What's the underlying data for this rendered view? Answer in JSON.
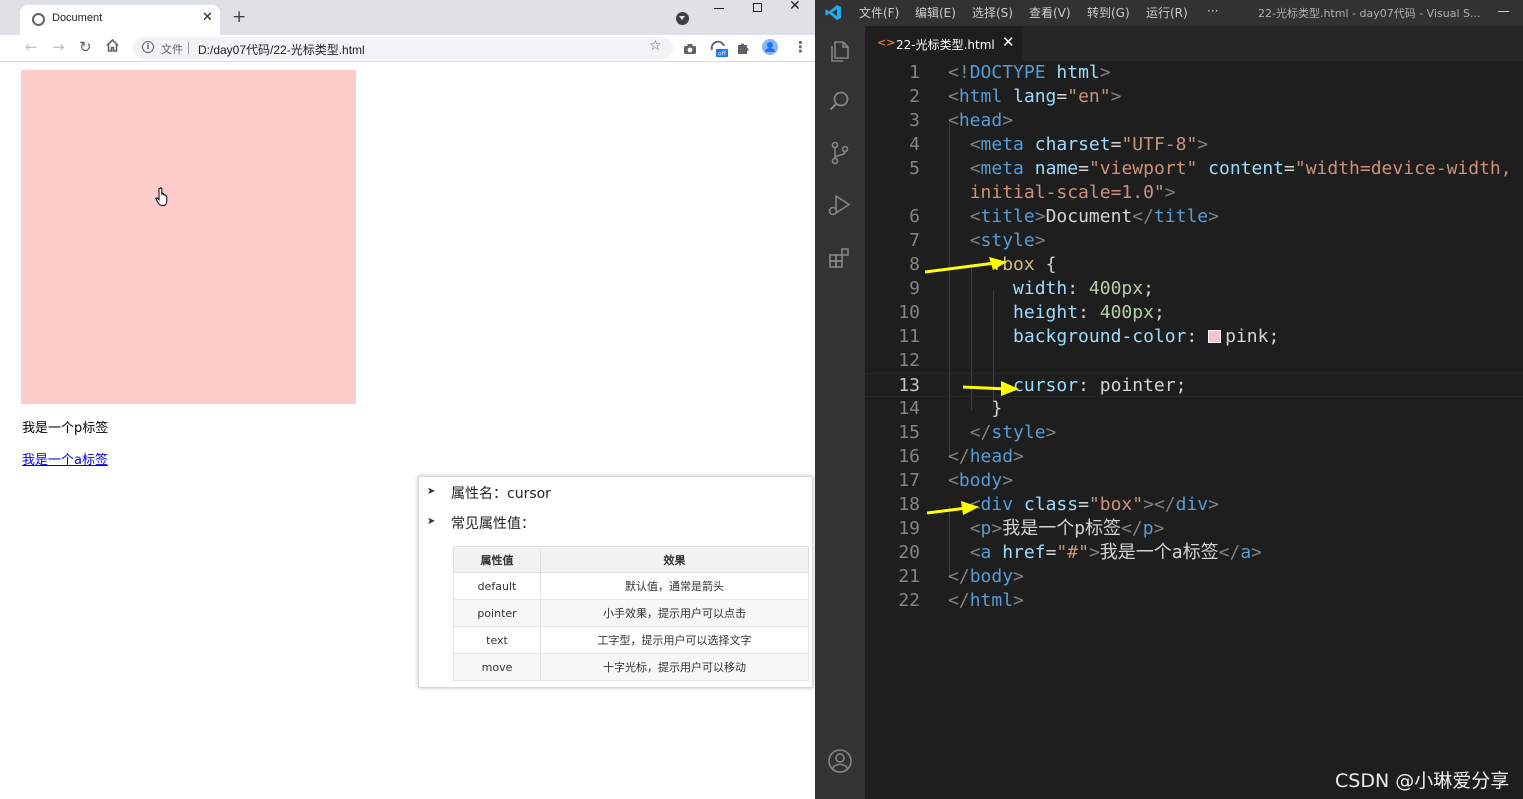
{
  "browser": {
    "tab_title": "Document",
    "omnibox_label": "文件",
    "url": "D:/day07代码/22-光标类型.html",
    "extension_badge": "off"
  },
  "page": {
    "p_text": "我是一个p标签",
    "a_text": "我是一个a标签",
    "box_color": "#ffcccc"
  },
  "slide": {
    "bullet1": "属性名：cursor",
    "bullet2": "常见属性值：",
    "table_headers": [
      "属性值",
      "效果"
    ],
    "table_rows": [
      [
        "default",
        "默认值，通常是箭头"
      ],
      [
        "pointer",
        "小手效果，提示用户可以点击"
      ],
      [
        "text",
        "工字型，提示用户可以选择文字"
      ],
      [
        "move",
        "十字光标，提示用户可以移动"
      ]
    ]
  },
  "vscode": {
    "menu": [
      "文件(F)",
      "编辑(E)",
      "选择(S)",
      "查看(V)",
      "转到(G)",
      "运行(R)",
      "···"
    ],
    "window_title": "22-光标类型.html - day07代码 - Visual S...",
    "tab_name": "22-光标类型.html",
    "line_numbers": [
      "1",
      "2",
      "3",
      "4",
      "5",
      "",
      "6",
      "7",
      "8",
      "9",
      "10",
      "11",
      "12",
      "13",
      "14",
      "15",
      "16",
      "17",
      "18",
      "19",
      "20",
      "21",
      "22"
    ],
    "current_line": "13"
  },
  "watermark": "CSDN @小琳爱分享"
}
